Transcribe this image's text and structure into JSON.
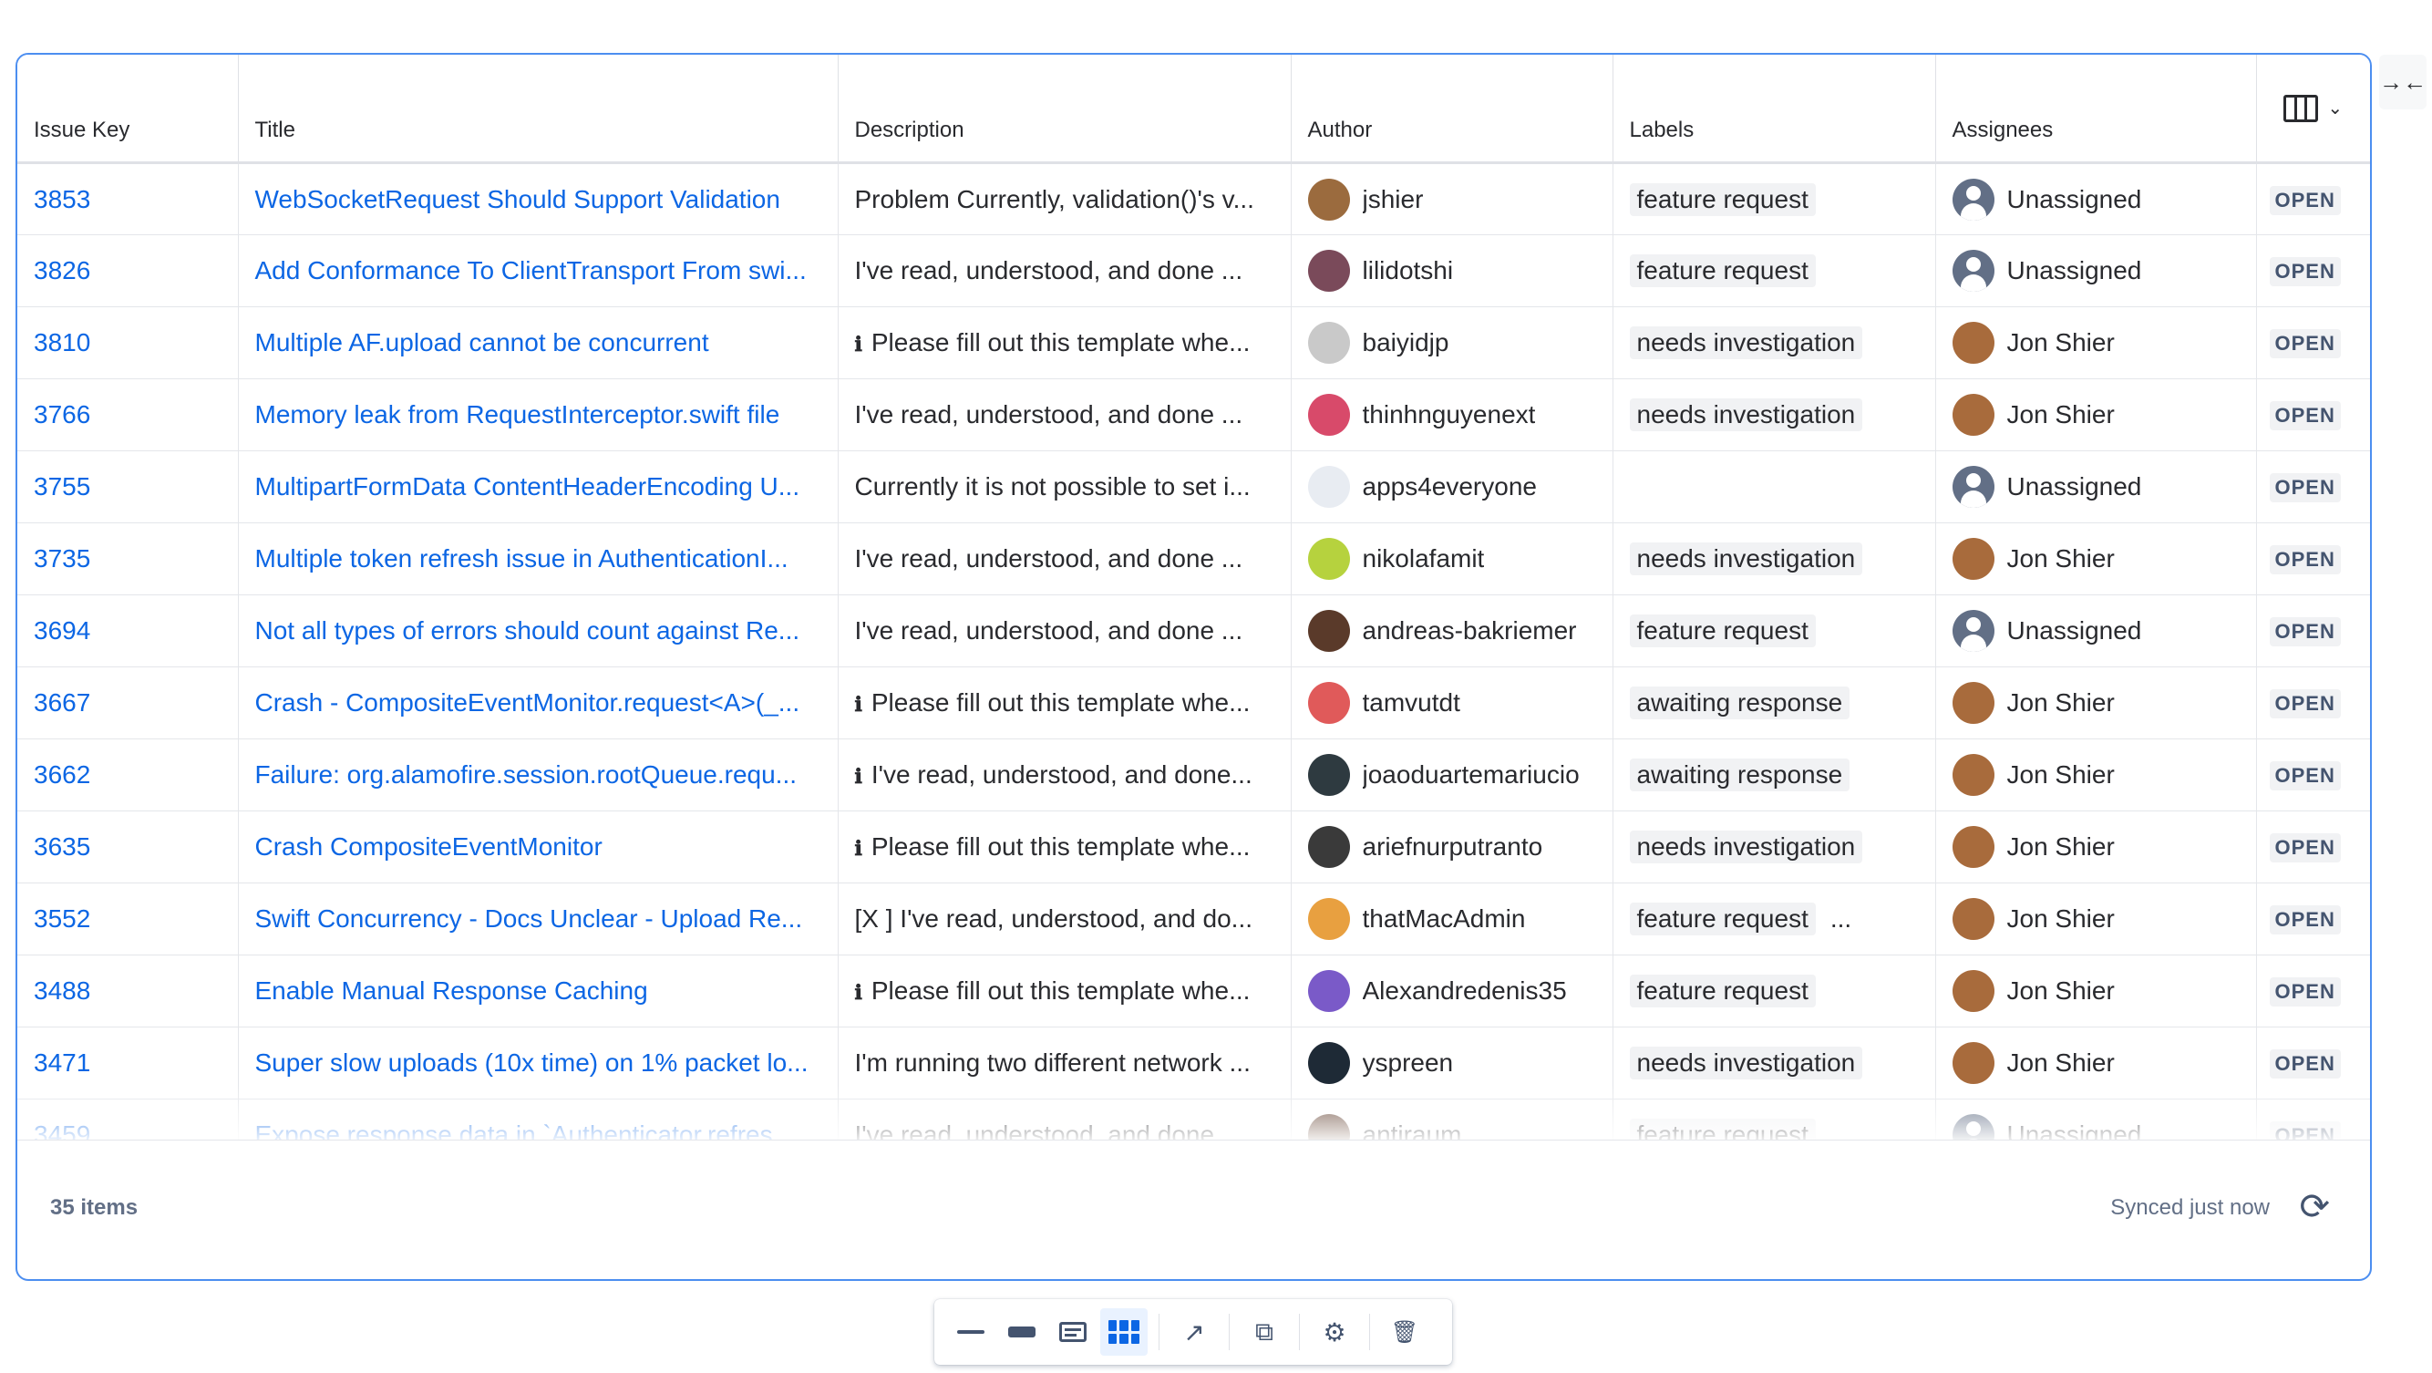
{
  "columns": {
    "issue_key": "Issue Key",
    "title": "Title",
    "description": "Description",
    "author": "Author",
    "labels": "Labels",
    "assignees": "Assignees"
  },
  "rows": [
    {
      "key": "3853",
      "title": "WebSocketRequest Should Support Validation",
      "desc": "Problem Currently, validation()'s v...",
      "desc_info": false,
      "author": "jshier",
      "author_color": "#9b6b3e",
      "labels": [
        "feature request"
      ],
      "more": false,
      "assignee": "Unassigned",
      "unassigned": true,
      "status": "OPEN"
    },
    {
      "key": "3826",
      "title": "Add Conformance To ClientTransport From swi...",
      "desc": "I've read, understood, and done ...",
      "desc_info": false,
      "author": "lilidotshi",
      "author_color": "#7a4a5a",
      "labels": [
        "feature request"
      ],
      "more": false,
      "assignee": "Unassigned",
      "unassigned": true,
      "status": "OPEN"
    },
    {
      "key": "3810",
      "title": "Multiple AF.upload cannot be concurrent",
      "desc": "Please fill out this template whe...",
      "desc_info": true,
      "author": "baiyidjp",
      "author_color": "#c9c9c9",
      "labels": [
        "needs investigation"
      ],
      "more": false,
      "assignee": "Jon Shier",
      "unassigned": false,
      "status": "OPEN"
    },
    {
      "key": "3766",
      "title": "Memory leak from RequestInterceptor.swift file",
      "desc": "I've read, understood, and done ...",
      "desc_info": false,
      "author": "thinhnguyenext",
      "author_color": "#d84a6a",
      "labels": [
        "needs investigation"
      ],
      "more": false,
      "assignee": "Jon Shier",
      "unassigned": false,
      "status": "OPEN"
    },
    {
      "key": "3755",
      "title": "MultipartFormData ContentHeaderEncoding U...",
      "desc": "Currently it is not possible to set i...",
      "desc_info": false,
      "author": "apps4everyone",
      "author_color": "#e8ecf2",
      "labels": [],
      "more": false,
      "assignee": "Unassigned",
      "unassigned": true,
      "status": "OPEN"
    },
    {
      "key": "3735",
      "title": "Multiple token refresh issue in AuthenticationI...",
      "desc": "I've read, understood, and done ...",
      "desc_info": false,
      "author": "nikolafamit",
      "author_color": "#b6d23e",
      "labels": [
        "needs investigation"
      ],
      "more": false,
      "assignee": "Jon Shier",
      "unassigned": false,
      "status": "OPEN"
    },
    {
      "key": "3694",
      "title": "Not all types of errors should count against Re...",
      "desc": "I've read, understood, and done ...",
      "desc_info": false,
      "author": "andreas-bakriemer",
      "author_color": "#5a3a2a",
      "labels": [
        "feature request"
      ],
      "more": false,
      "assignee": "Unassigned",
      "unassigned": true,
      "status": "OPEN"
    },
    {
      "key": "3667",
      "title": "Crash - CompositeEventMonitor.request<A>(_...",
      "desc": "Please fill out this template whe...",
      "desc_info": true,
      "author": "tamvutdt",
      "author_color": "#e05a5a",
      "labels": [
        "awaiting response"
      ],
      "more": false,
      "assignee": "Jon Shier",
      "unassigned": false,
      "status": "OPEN"
    },
    {
      "key": "3662",
      "title": "Failure: org.alamofire.session.rootQueue.requ...",
      "desc": "I've read, understood, and done...",
      "desc_info": true,
      "author": "joaoduartemariucio",
      "author_color": "#2e3a40",
      "labels": [
        "awaiting response"
      ],
      "more": false,
      "assignee": "Jon Shier",
      "unassigned": false,
      "status": "OPEN"
    },
    {
      "key": "3635",
      "title": "Crash CompositeEventMonitor",
      "desc": "Please fill out this template whe...",
      "desc_info": true,
      "author": "ariefnurputranto",
      "author_color": "#3a3a3a",
      "labels": [
        "needs investigation"
      ],
      "more": false,
      "assignee": "Jon Shier",
      "unassigned": false,
      "status": "OPEN"
    },
    {
      "key": "3552",
      "title": "Swift Concurrency - Docs Unclear - Upload Re...",
      "desc": "[X ] I've read, understood, and do...",
      "desc_info": false,
      "author": "thatMacAdmin",
      "author_color": "#e8a040",
      "labels": [
        "feature request"
      ],
      "more": true,
      "assignee": "Jon Shier",
      "unassigned": false,
      "status": "OPEN"
    },
    {
      "key": "3488",
      "title": "Enable Manual Response Caching",
      "desc": "Please fill out this template whe...",
      "desc_info": true,
      "author": "Alexandredenis35",
      "author_color": "#7a5ac8",
      "labels": [
        "feature request"
      ],
      "more": false,
      "assignee": "Jon Shier",
      "unassigned": false,
      "status": "OPEN"
    },
    {
      "key": "3471",
      "title": "Super slow uploads (10x time) on 1% packet lo...",
      "desc": "I'm running two different network ...",
      "desc_info": false,
      "author": "yspreen",
      "author_color": "#1e2a36",
      "labels": [
        "needs investigation"
      ],
      "more": false,
      "assignee": "Jon Shier",
      "unassigned": false,
      "status": "OPEN"
    },
    {
      "key": "3459",
      "title": "Expose response data in `Authenticator.refres...",
      "desc": "I've read, understood, and done ...",
      "desc_info": false,
      "author": "antiraum",
      "author_color": "#6a4a3a",
      "labels": [
        "feature request"
      ],
      "more": false,
      "assignee": "Unassigned",
      "unassigned": true,
      "status": "OPEN"
    }
  ],
  "footer": {
    "count": "35 items",
    "synced": "Synced just now"
  },
  "icons": {
    "info": "ℹ",
    "more": "...",
    "collapse": "→←",
    "refresh": "⟳",
    "chevron": "⌄",
    "external": "↗",
    "copy": "⧉",
    "gear": "⚙",
    "trash": "🗑"
  },
  "colors": {
    "accent": "#0c66e4",
    "frame_border": "#4c8ef0",
    "assignee_avatar": "#a86b3c"
  }
}
